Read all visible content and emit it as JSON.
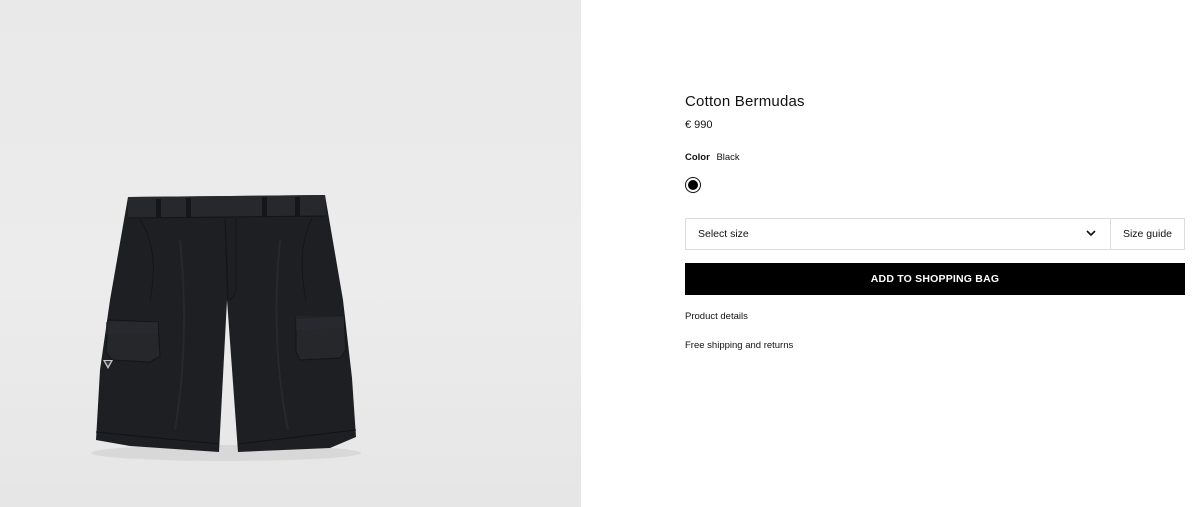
{
  "product": {
    "name": "Cotton Bermudas",
    "price": "€ 990",
    "image_alt": "Black cotton cargo bermuda shorts"
  },
  "color": {
    "label": "Color",
    "selected": "Black",
    "swatches": [
      {
        "name": "Black",
        "hex": "#000000",
        "selected": true
      }
    ]
  },
  "size": {
    "placeholder": "Select size",
    "guide_label": "Size guide"
  },
  "actions": {
    "add_to_bag": "ADD TO SHOPPING BAG"
  },
  "links": {
    "product_details": "Product details",
    "shipping": "Free shipping and returns"
  },
  "colors": {
    "gallery_bg": "#ebebeb",
    "button_bg": "#000000",
    "border": "#dcdcdc"
  }
}
